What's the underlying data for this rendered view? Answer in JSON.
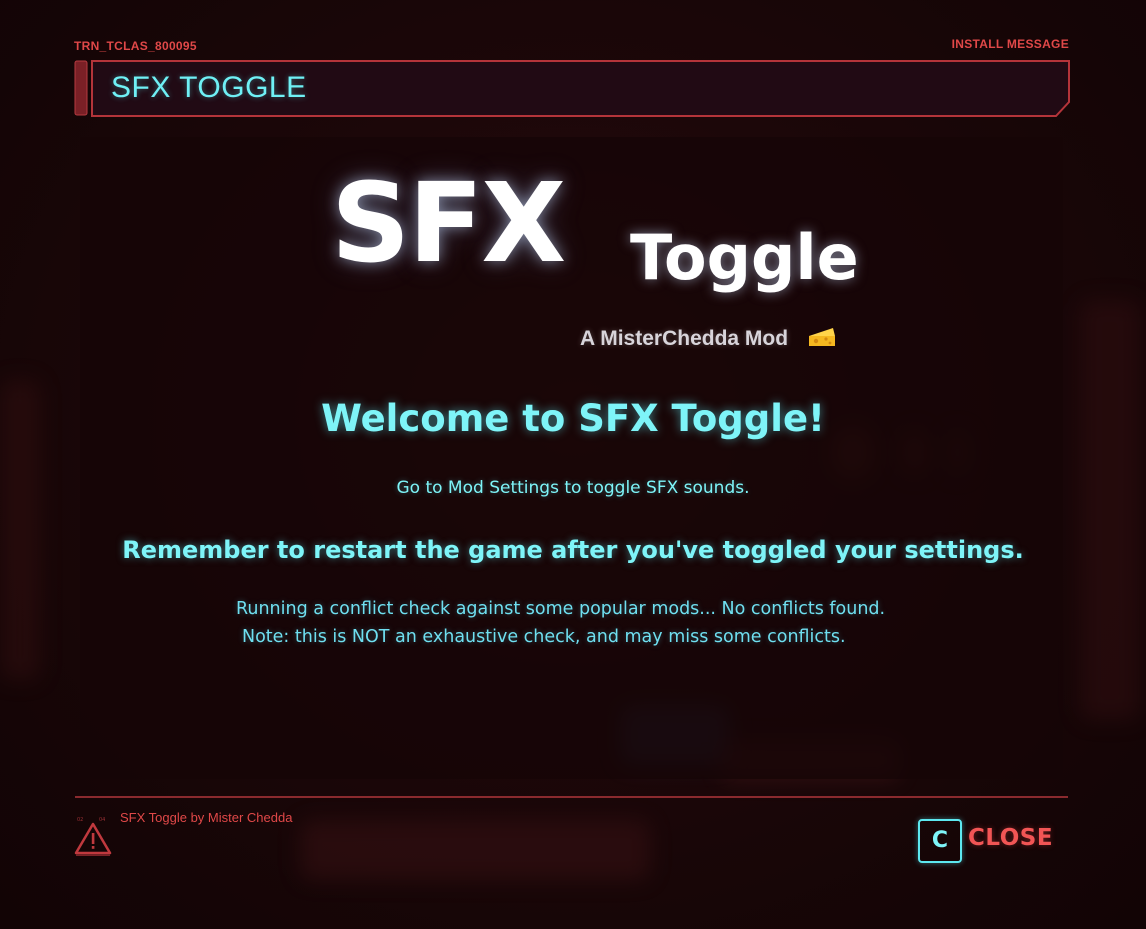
{
  "header": {
    "code": "TRN_TCLAS_800095",
    "category": "INSTALL MESSAGE",
    "title": "SFX TOGGLE"
  },
  "logo": {
    "big": "SFX",
    "small": "Toggle",
    "byline": "A MisterChedda Mod",
    "emoji_icon": "cheese-icon"
  },
  "message": {
    "welcome": "Welcome to SFX Toggle!",
    "instruction": "Go to Mod Settings to toggle SFX sounds.",
    "reminder": "Remember to restart the game after you've toggled your settings.",
    "conflict_check": "Running a conflict check against some popular mods... No conflicts found.",
    "note": "Note: this is NOT an exhaustive check, and may miss some conflicts."
  },
  "footer": {
    "mod_credit": "SFX Toggle by Mister Chedda",
    "warning_icon": "warning-icon",
    "close_key": "C",
    "close_label": "CLOSE"
  },
  "colors": {
    "accent_cyan": "#7ef4f8",
    "accent_red": "#e04848",
    "background": "#1a0606"
  }
}
